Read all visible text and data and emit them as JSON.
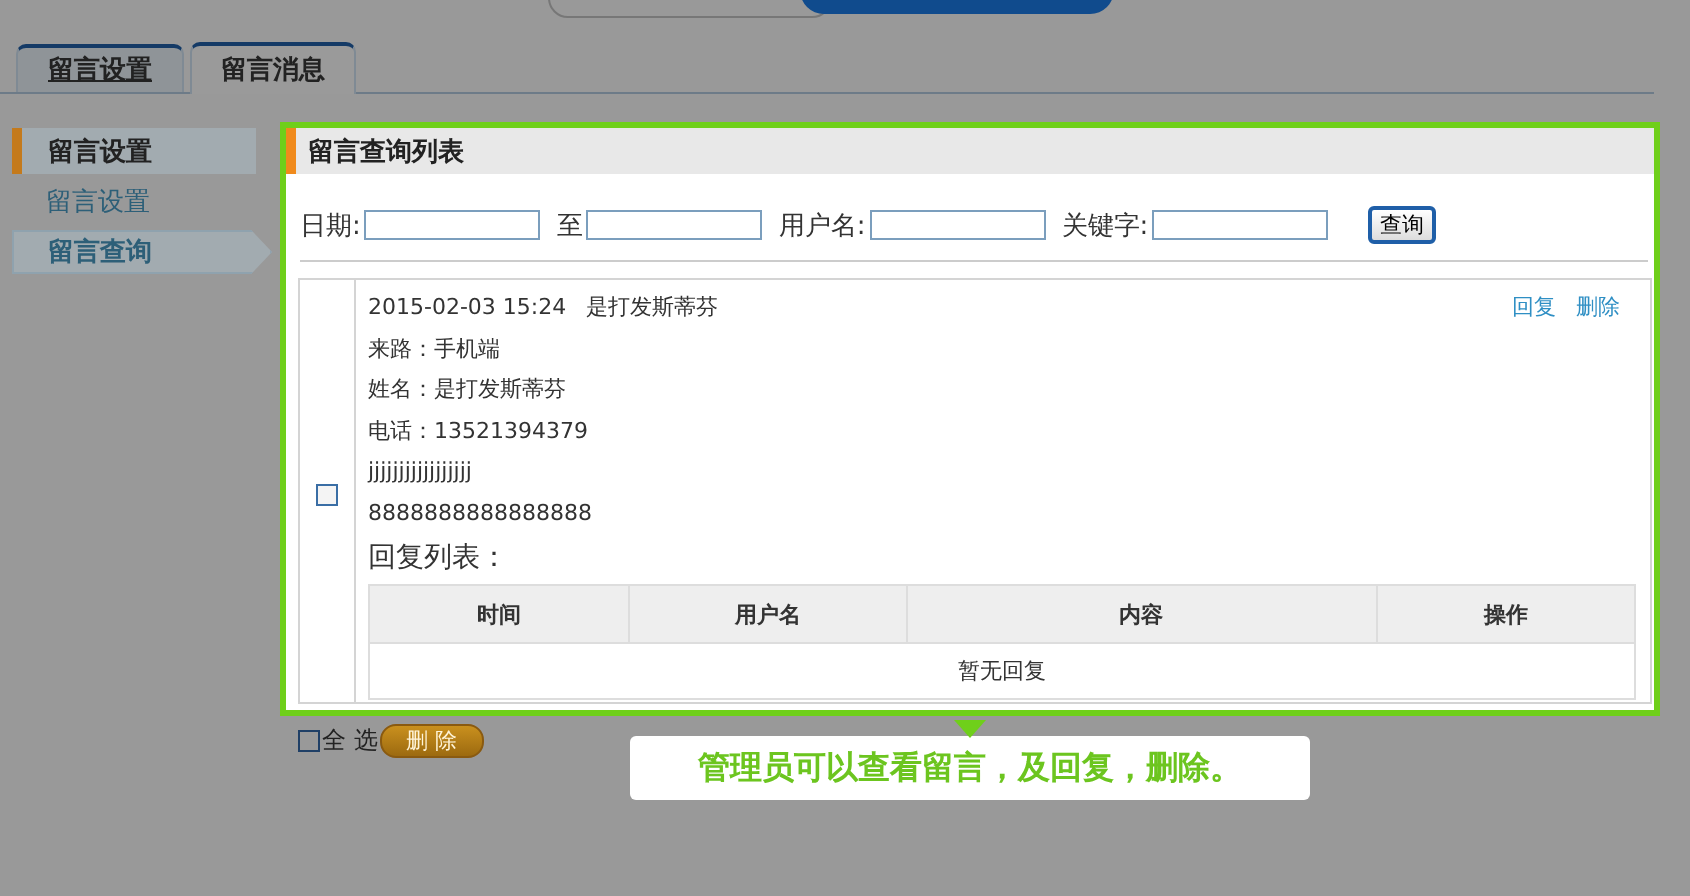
{
  "tabs": [
    {
      "label": "留言设置",
      "selected": false
    },
    {
      "label": "留言消息",
      "selected": true
    }
  ],
  "sidebar": {
    "heading": "留言设置",
    "items": [
      {
        "label": "留言设置",
        "selected": false
      },
      {
        "label": "留言查询",
        "selected": true
      }
    ]
  },
  "panel": {
    "title": "留言查询列表",
    "filters": [
      {
        "label": "日期:"
      },
      {
        "label": "至"
      },
      {
        "label": "用户名:"
      },
      {
        "label": "关键字:"
      }
    ],
    "search_button": "查询"
  },
  "messages": [
    {
      "checked": false,
      "time": "2015-02-03 15:24",
      "name": "是打发斯蒂芬",
      "actions": [
        "回复",
        "删除"
      ],
      "lines": [
        "来路：手机端",
        "姓名：是打发斯蒂芬",
        "电话：13521394379",
        "jjjjjjjjjjjjjjjjj",
        "8888888888888888"
      ],
      "reply_title": "回复列表：",
      "reply_columns": [
        "时间",
        "用户名",
        "内容",
        "操作"
      ],
      "reply_empty": "暂无回复"
    }
  ],
  "footer": {
    "select_all": {
      "label": "全 选",
      "checked": false
    },
    "delete_button": "删 除"
  },
  "tip": "管理员可以查看留言，及回复，删除。"
}
